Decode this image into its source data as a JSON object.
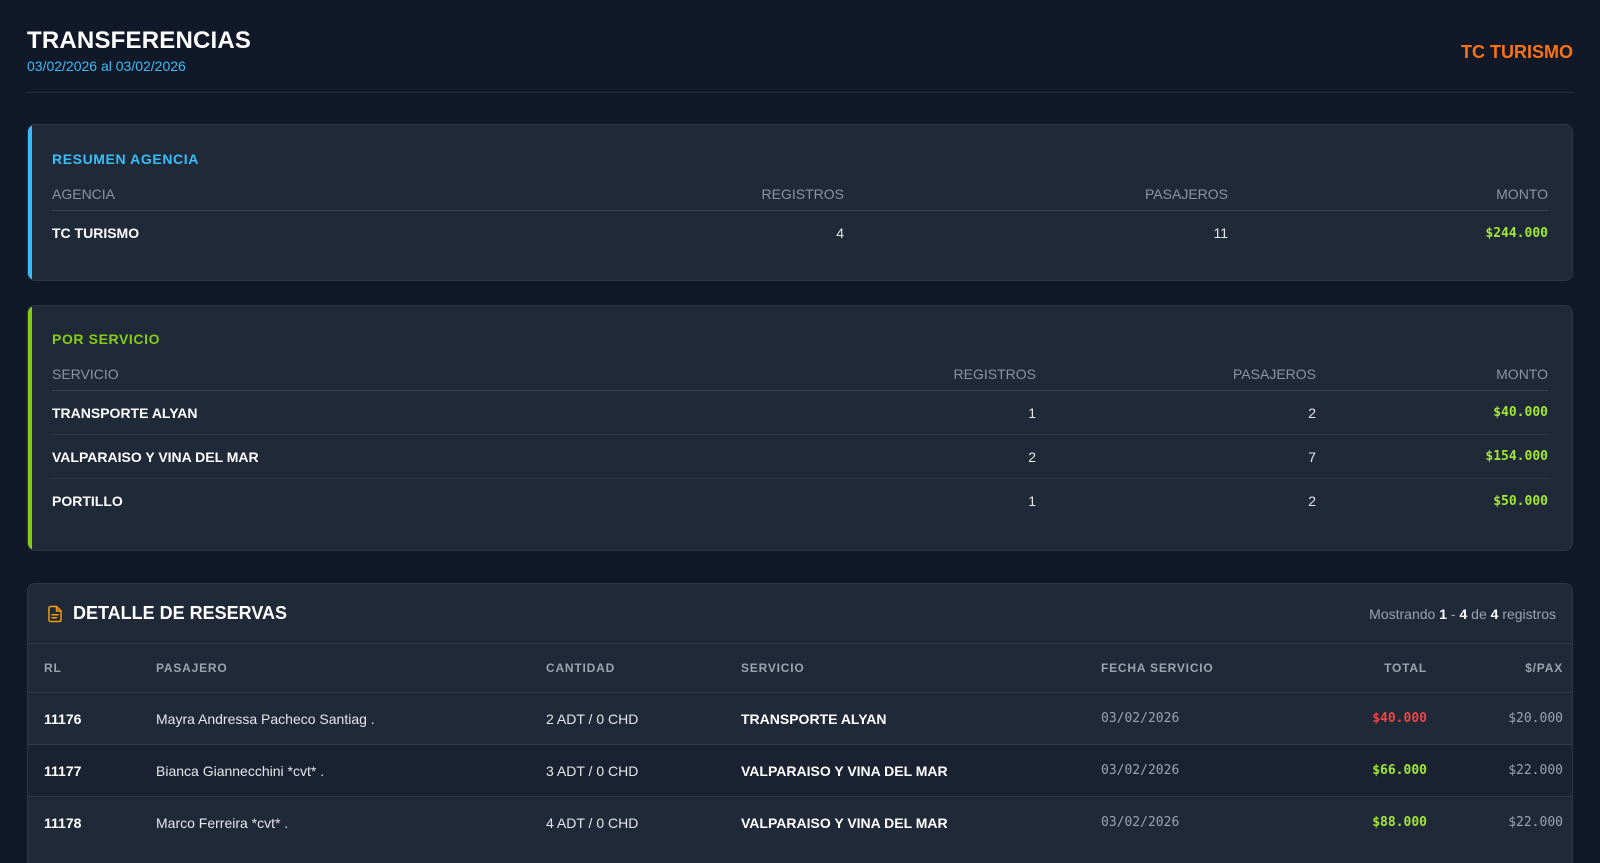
{
  "header": {
    "title": "TRANSFERENCIAS",
    "date_range": "03/02/2026 al 03/02/2026",
    "brand": "TC TURISMO"
  },
  "colors": {
    "background": "#111827",
    "card": "#1f2937",
    "accent_cyan": "#38bdf8",
    "accent_green": "#84cc16",
    "brand_orange": "#f97316",
    "money_green": "#a3e635",
    "money_red": "#ef4444"
  },
  "summary": {
    "title": "RESUMEN AGENCIA",
    "columns": [
      "AGENCIA",
      "REGISTROS",
      "PASAJEROS",
      "MONTO"
    ],
    "rows": [
      {
        "agencia": "TC TURISMO",
        "registros": "4",
        "pasajeros": "11",
        "monto": "$244.000"
      }
    ]
  },
  "by_service": {
    "title": "POR SERVICIO",
    "columns": [
      "SERVICIO",
      "REGISTROS",
      "PASAJEROS",
      "MONTO"
    ],
    "rows": [
      {
        "servicio": "TRANSPORTE ALYAN",
        "registros": "1",
        "pasajeros": "2",
        "monto": "$40.000"
      },
      {
        "servicio": "VALPARAISO Y VINA DEL MAR",
        "registros": "2",
        "pasajeros": "7",
        "monto": "$154.000"
      },
      {
        "servicio": "PORTILLO",
        "registros": "1",
        "pasajeros": "2",
        "monto": "$50.000"
      }
    ]
  },
  "detail": {
    "title": "DETALLE DE RESERVAS",
    "icon": "document-icon",
    "showing": {
      "prefix": "Mostrando",
      "from": "1",
      "sep": "-",
      "to": "4",
      "of": "de",
      "total": "4",
      "suffix": "registros"
    },
    "columns": [
      "RL",
      "PASAJERO",
      "CANTIDAD",
      "SERVICIO",
      "FECHA SERVICIO",
      "TOTAL",
      "$/PAX"
    ],
    "rows": [
      {
        "rl": "11176",
        "pasajero": "Mayra Andressa Pacheco Santiag .",
        "cantidad": "2 ADT / 0 CHD",
        "servicio": "TRANSPORTE ALYAN",
        "fecha": "03/02/2026",
        "total": "$40.000",
        "total_status": "red",
        "pax": "$20.000"
      },
      {
        "rl": "11177",
        "pasajero": "Bianca Giannecchini *cvt* .",
        "cantidad": "3 ADT / 0 CHD",
        "servicio": "VALPARAISO Y VINA DEL MAR",
        "fecha": "03/02/2026",
        "total": "$66.000",
        "total_status": "green",
        "pax": "$22.000"
      },
      {
        "rl": "11178",
        "pasajero": "Marco Ferreira *cvt* .",
        "cantidad": "4 ADT / 0 CHD",
        "servicio": "VALPARAISO Y VINA DEL MAR",
        "fecha": "03/02/2026",
        "total": "$88.000",
        "total_status": "green",
        "pax": "$22.000"
      }
    ]
  }
}
